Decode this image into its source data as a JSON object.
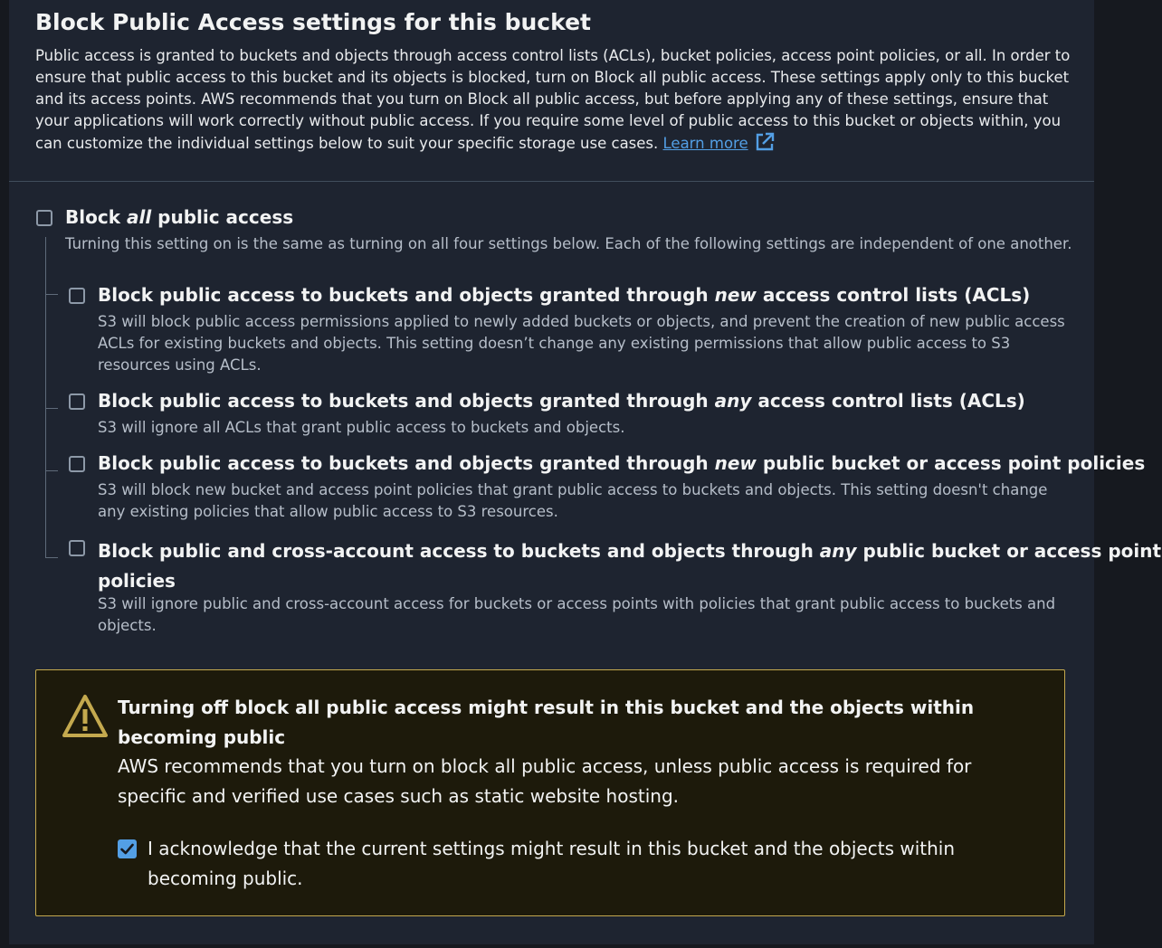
{
  "section": {
    "title": "Block Public Access settings for this bucket",
    "description": "Public access is granted to buckets and objects through access control lists (ACLs), bucket policies, access point policies, or all. In order to ensure that public access to this bucket and its objects is blocked, turn on Block all public access. These settings apply only to this bucket and its access points. AWS recommends that you turn on Block all public access, but before applying any of these settings, ensure that your applications will work correctly without public access. If you require some level of public access to this bucket or objects within, you can customize the individual settings below to suit your specific storage use cases.",
    "learn_more": "Learn more"
  },
  "block_all": {
    "label_pre": "Block ",
    "label_em": "all",
    "label_post": " public access",
    "description": "Turning this setting on is the same as turning on all four settings below. Each of the following settings are independent of one another.",
    "checked": false
  },
  "options": [
    {
      "label_pre": "Block public access to buckets and objects granted through ",
      "label_em": "new",
      "label_post": " access control lists (ACLs)",
      "description": "S3 will block public access permissions applied to newly added buckets or objects, and prevent the creation of new public access ACLs for existing buckets and objects. This setting doesn’t change any existing permissions that allow public access to S3 resources using ACLs.",
      "checked": false
    },
    {
      "label_pre": "Block public access to buckets and objects granted through ",
      "label_em": "any",
      "label_post": " access control lists (ACLs)",
      "description": "S3 will ignore all ACLs that grant public access to buckets and objects.",
      "checked": false
    },
    {
      "label_pre": "Block public access to buckets and objects granted through ",
      "label_em": "new",
      "label_post": " public bucket or access point policies",
      "description": "S3 will block new bucket and access point policies that grant public access to buckets and objects. This setting doesn't change any existing policies that allow public access to S3 resources.",
      "checked": false
    },
    {
      "label_pre": "Block public and cross-account access to buckets and objects through ",
      "label_em": "any",
      "label_post": " public bucket or access point",
      "label_line2": "policies",
      "description": "S3 will ignore public and cross-account access for buckets or access points with policies that grant public access to buckets and objects.",
      "checked": false
    }
  ],
  "warning": {
    "title": "Turning off block all public access might result in this bucket and the objects within becoming public",
    "text": "AWS recommends that you turn on block all public access, unless public access is required for specific and verified use cases such as static website hosting.",
    "acknowledge_label": "I acknowledge that the current settings might result in this bucket and the objects within becoming public.",
    "acknowledge_checked": true,
    "icon": "warning-triangle-icon"
  },
  "colors": {
    "link": "#539fe5",
    "warning_border": "#c4a94e",
    "checkbox_checked": "#539fe5"
  }
}
